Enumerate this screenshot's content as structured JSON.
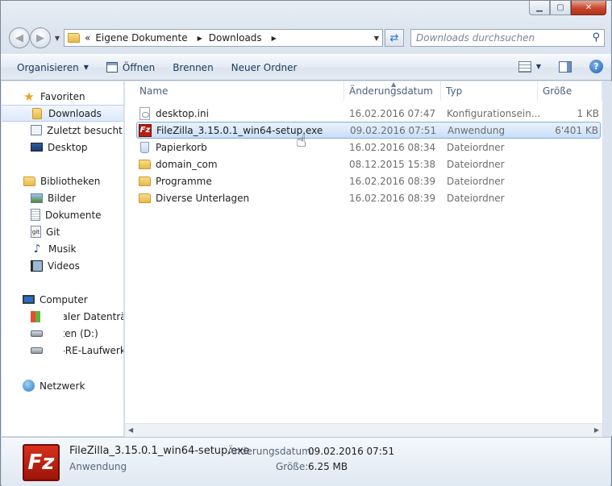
{
  "window": {
    "caption_minimize": "▁",
    "caption_maximize": "▢",
    "caption_close": "✕"
  },
  "address_bar": {
    "overflow": "«",
    "crumbs": [
      "Eigene Dokumente",
      "Downloads"
    ],
    "search_placeholder": "Downloads durchsuchen"
  },
  "toolbar": {
    "organize": "Organisieren",
    "open": "Öffnen",
    "burn": "Brennen",
    "new_folder": "Neuer Ordner"
  },
  "nav": {
    "favorites": "Favoriten",
    "downloads": "Downloads",
    "recent": "Zuletzt besucht",
    "desktop": "Desktop",
    "libraries": "Bibliotheken",
    "pictures": "Bilder",
    "documents": "Dokumente",
    "git": "Git",
    "music": "Musik",
    "videos": "Videos",
    "computer": "Computer",
    "local_disk": "Lokaler Datenträger",
    "data_d": "Daten (D:)",
    "bd_drive": "BD-RE-Laufwerk (",
    "network": "Netzwerk"
  },
  "columns": {
    "name": "Name",
    "modified": "Änderungsdatum",
    "type": "Typ",
    "size": "Größe"
  },
  "files": [
    {
      "name": "desktop.ini",
      "modified": "16.02.2016 07:47",
      "type": "Konfigurationsein...",
      "size": "1 KB",
      "icon": "ini-file-icon"
    },
    {
      "name": "FileZilla_3.15.0.1_win64-setup.exe",
      "modified": "09.02.2016 07:51",
      "type": "Anwendung",
      "size": "6'401 KB",
      "icon": "filezilla-icon"
    },
    {
      "name": "Papierkorb",
      "modified": "16.02.2016 08:34",
      "type": "Dateiordner",
      "size": "",
      "icon": "recycle-bin-icon"
    },
    {
      "name": "domain_com",
      "modified": "08.12.2015 15:38",
      "type": "Dateiordner",
      "size": "",
      "icon": "folder-icon"
    },
    {
      "name": "Programme",
      "modified": "16.02.2016 08:39",
      "type": "Dateiordner",
      "size": "",
      "icon": "folder-icon"
    },
    {
      "name": "Diverse Unterlagen",
      "modified": "16.02.2016 08:39",
      "type": "Dateiordner",
      "size": "",
      "icon": "folder-icon"
    }
  ],
  "details": {
    "filename": "FileZilla_3.15.0.1_win64-setup.exe",
    "type": "Anwendung",
    "modified_label": "Änderungsdatum:",
    "modified_value": "09.02.2016 07:51",
    "size_label": "Größe:",
    "size_value": "6.25 MB",
    "big_icon_text": "Fz"
  },
  "colors": {
    "selection_border": "#84acdd",
    "filezilla_red": "#b21e13",
    "toolbar_text": "#1e395b"
  }
}
